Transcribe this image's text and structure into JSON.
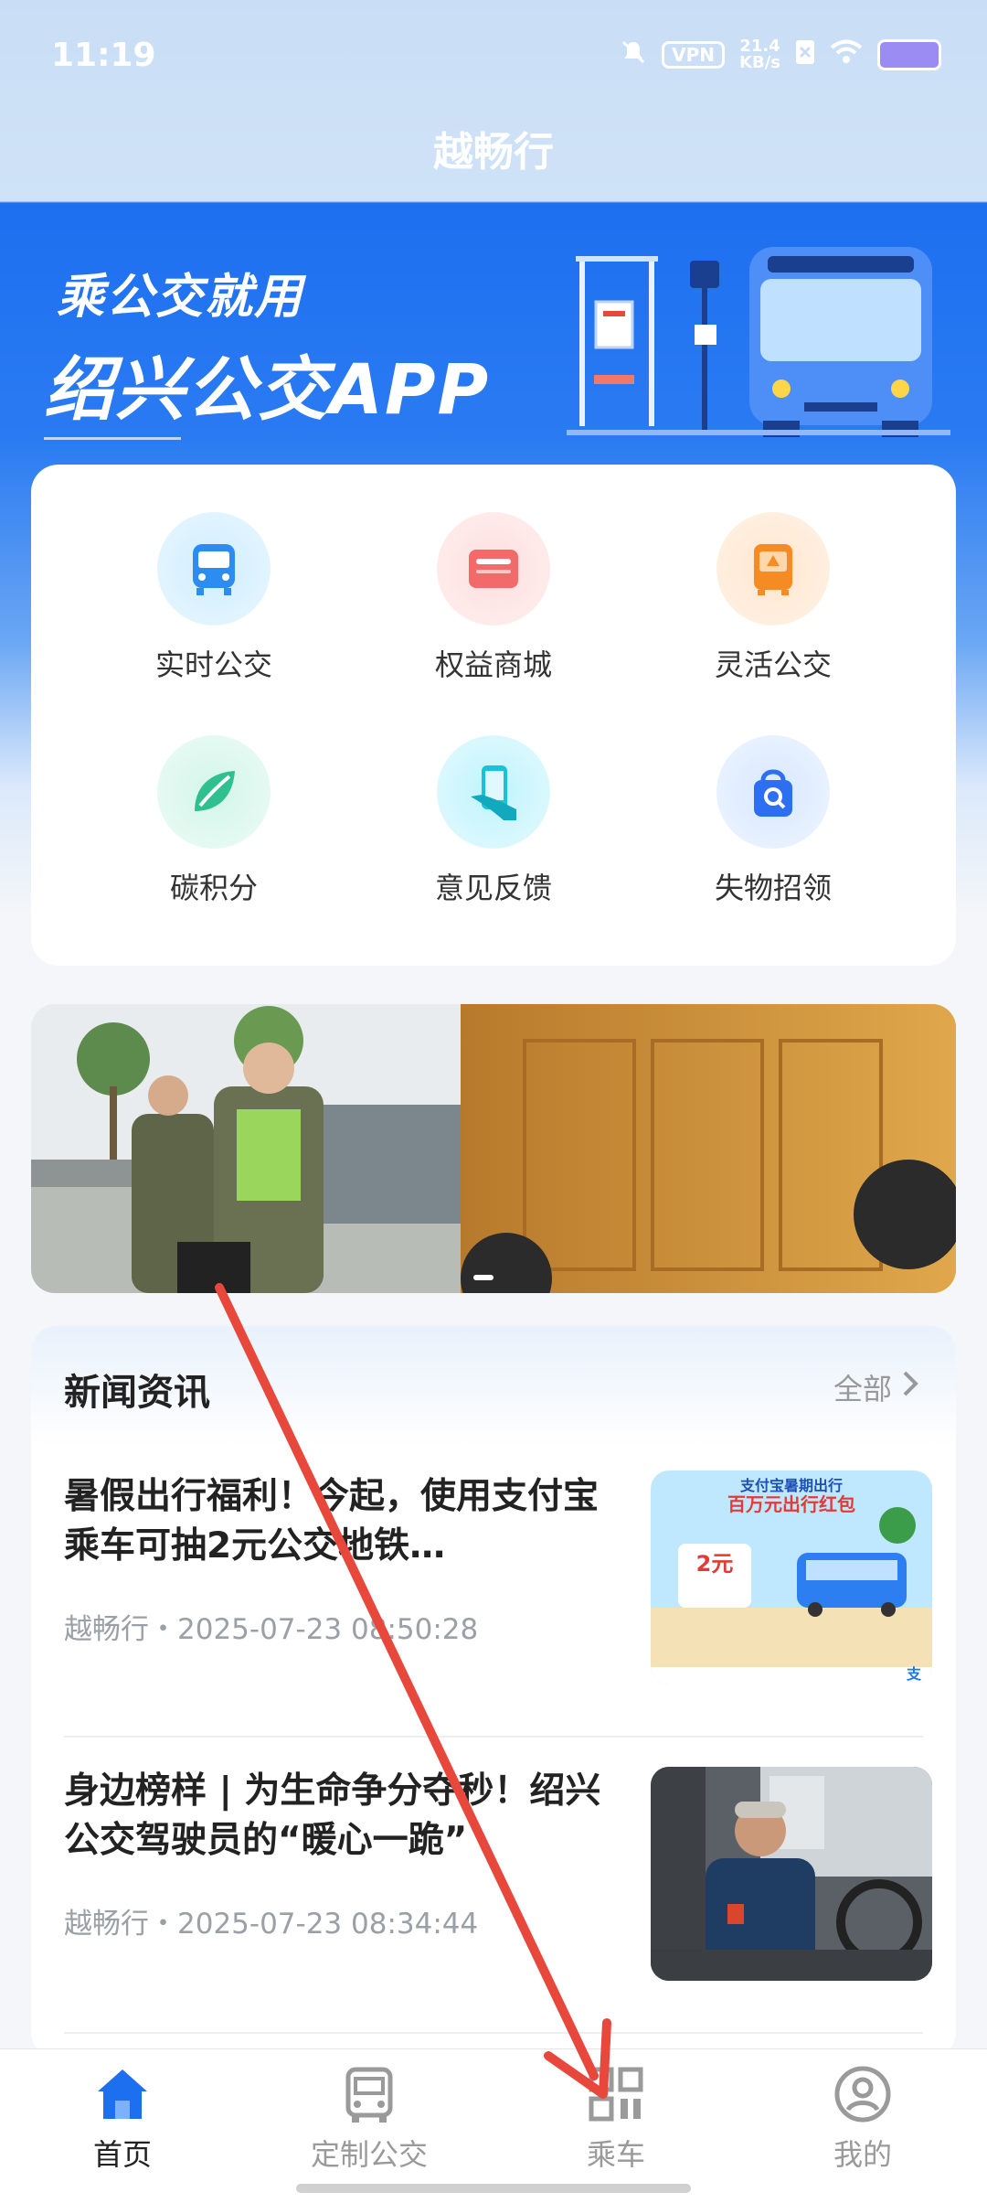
{
  "status_bar": {
    "time": "11:19",
    "vpn_label": "VPN",
    "speed_value": "21.4",
    "speed_unit": "KB/s"
  },
  "app": {
    "title": "越畅行"
  },
  "banner": {
    "line1": "乘公交就用",
    "line2": "绍兴公交APP"
  },
  "menu": {
    "items": [
      {
        "label": "实时公交",
        "icon": "bus-icon"
      },
      {
        "label": "权益商城",
        "icon": "card-icon"
      },
      {
        "label": "灵活公交",
        "icon": "flexible-bus-icon"
      },
      {
        "label": "碳积分",
        "icon": "leaf-icon"
      },
      {
        "label": "意见反馈",
        "icon": "phone-hand-icon"
      },
      {
        "label": "失物招领",
        "icon": "lost-bag-icon"
      }
    ]
  },
  "news": {
    "title": "新闻资讯",
    "all_label": "全部",
    "articles": [
      {
        "title": "暑假出行福利！今起，使用支付宝乘车可抽2元公交地铁…",
        "meta": "越畅行・2025-07-23 08:50:28",
        "thumb_text1": "支付宝暑期出行",
        "thumb_text2": "百万元出行红包",
        "thumb_text3": "2元",
        "thumb_text4": "支"
      },
      {
        "title": "身边榜样 | 为生命争分夺秒！绍兴公交驾驶员的“暖心一跪”",
        "meta": "越畅行・2025-07-23 08:34:44"
      }
    ]
  },
  "bottom_nav": {
    "items": [
      {
        "label": "首页",
        "icon": "home-icon",
        "active": true
      },
      {
        "label": "定制公交",
        "icon": "custom-bus-icon",
        "active": false
      },
      {
        "label": "乘车",
        "icon": "qr-code-icon",
        "active": false
      },
      {
        "label": "我的",
        "icon": "profile-icon",
        "active": false
      }
    ]
  },
  "colors": {
    "primary": "#1e6ff0",
    "active_nav": "#1e6ff0",
    "inactive_nav": "#9a9a9a",
    "annotation_arrow": "#e8473c"
  }
}
